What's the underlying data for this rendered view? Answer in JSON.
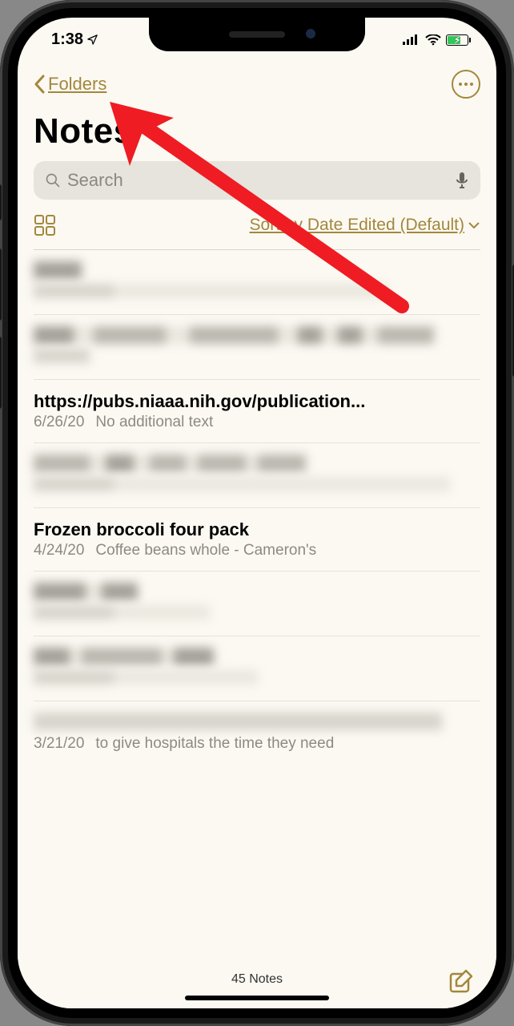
{
  "status": {
    "time": "1:38",
    "location_icon": "location-arrow",
    "battery_color": "#33c759"
  },
  "nav": {
    "back_label": "Folders",
    "more_icon": "ellipsis"
  },
  "title": "Notes",
  "search": {
    "placeholder": "Search"
  },
  "sort": {
    "label": "Sort by Date Edited (Default)"
  },
  "notes": {
    "n3": {
      "title": "https://pubs.niaaa.nih.gov/publication...",
      "date": "6/26/20",
      "preview": "No additional text"
    },
    "n5": {
      "title": "Frozen broccoli four pack",
      "date": "4/24/20",
      "preview": "Coffee beans whole - Cameron's"
    },
    "n8": {
      "date": "3/21/20",
      "preview": "to give hospitals the time they need"
    }
  },
  "footer": {
    "count": "45 Notes"
  },
  "accent": "#a3873c"
}
